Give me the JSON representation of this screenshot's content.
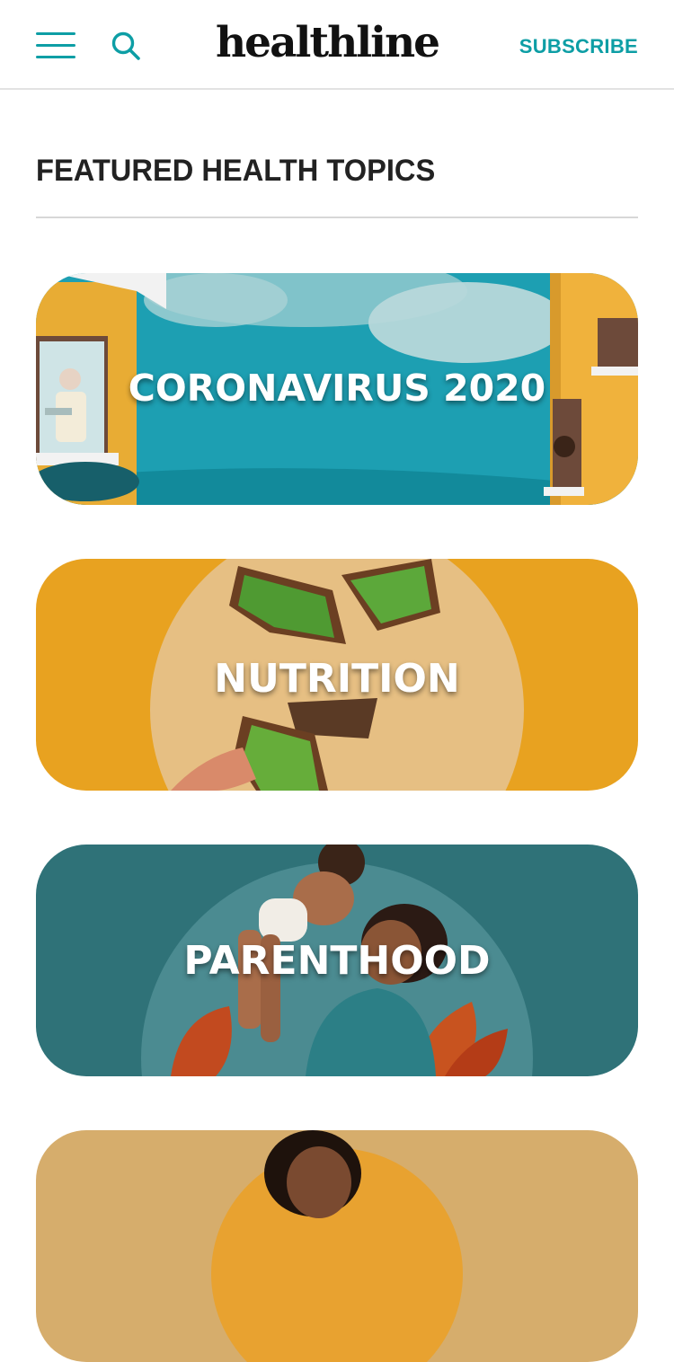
{
  "header": {
    "logo_text": "healthline",
    "subscribe_label": "SUBSCRIBE",
    "menu_icon": "hamburger-menu-icon",
    "search_icon": "search-icon",
    "accent_color": "#0d9ea5"
  },
  "section": {
    "title": "FEATURED HEALTH TOPICS"
  },
  "topics": [
    {
      "label": "CORONAVIRUS 2020",
      "color": "#1a9eb0"
    },
    {
      "label": "NUTRITION",
      "color": "#e8a220"
    },
    {
      "label": "PARENTHOOD",
      "color": "#2f7278"
    },
    {
      "label": "",
      "color": "#d6ad6c"
    }
  ]
}
